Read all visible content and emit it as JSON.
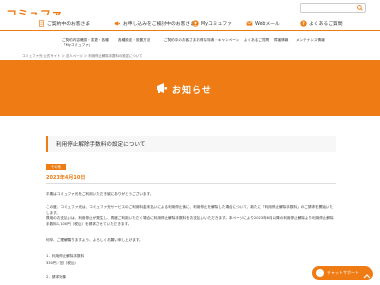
{
  "header": {
    "logo_text": "コミュファ",
    "logo_sub": "commufa",
    "search_placeholder": "サイト内を検索"
  },
  "mainnav": [
    {
      "label": "ご契約中のお客さま"
    },
    {
      "label": "お申し込みをご検討中のお客さま"
    },
    {
      "label": "Myコミュファ"
    },
    {
      "label": "Webメール"
    },
    {
      "label": "よくあるご質問"
    }
  ],
  "subnav": [
    {
      "label": "ご契約内容確認・変更・各種\n「Myコミュファ」"
    },
    {
      "label": "各種設定・設置方法"
    },
    {
      "label": "ご契約中のお客さまお得な特典・キャンペーン"
    },
    {
      "label": "よくあるご質問"
    },
    {
      "label": "障害情報"
    },
    {
      "label": "メンテナンス情報"
    }
  ],
  "breadcrumb": "コミュファ光 公式サイト ＞ 法人ページ ＞ 利用停止解除手数料の設定について",
  "banner": {
    "title": "お知らせ"
  },
  "article": {
    "title": "利用停止解除手数料の設定について",
    "tag": "その他",
    "date": "2023年4月10日",
    "paragraphs": [
      "平素はコミュファ光をご利用いただき誠にありがとうございます。",
      "この度、コミュファ光は、コミュファ光サービスのご利用料金未払いによる利用停止後に、利用停止を解除した場合について、新たに「利用停止解除手数料」のご請求を開始いたします。",
      "費用のお支払いは、利用停止が発生し、再度ご利用いただく場合に利用停止解除手数料をお支払いいただきます。本ページにより2023年6月以降の利用停止解除より利用停止解除手数料1,100円（税込）を請求させていただきます。",
      "何卒、ご理解賜りますよう、よろしくお願い申し上げます。",
      "1．利用停止解除手数料",
      "330円／回（税込）",
      "2．請求対象"
    ]
  },
  "chat": {
    "label": "チャットサポート"
  }
}
